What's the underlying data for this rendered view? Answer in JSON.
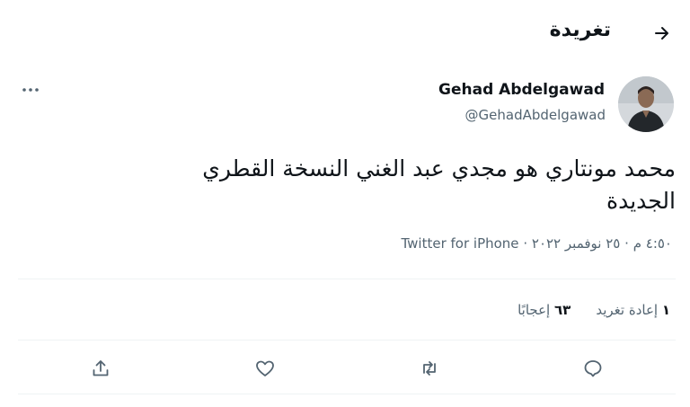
{
  "header": {
    "title": "تغريدة"
  },
  "author": {
    "name": "Gehad Abdelgawad",
    "handle": "@GehadAbdelgawad"
  },
  "tweet": {
    "line1": "محمد مونتاري هو مجدي عبد الغني النسخة القطري",
    "line2": "الجديدة",
    "time": "٤:٥٠ م",
    "date": "٢٥ نوفمبر ٢٠٢٢",
    "source": "Twitter for iPhone",
    "separator": "·"
  },
  "stats": {
    "retweets_count": "١",
    "retweets_label": "إعادة تغريد",
    "likes_count": "٦٣",
    "likes_label": "إعجابًا"
  },
  "icons": {
    "back": "arrow-right-icon",
    "more": "more-dots-icon",
    "reply": "reply-icon",
    "retweet": "retweet-icon",
    "like": "heart-icon",
    "share": "share-icon"
  },
  "colors": {
    "text": "#0f1419",
    "muted": "#536471",
    "divider": "#eff3f4"
  }
}
